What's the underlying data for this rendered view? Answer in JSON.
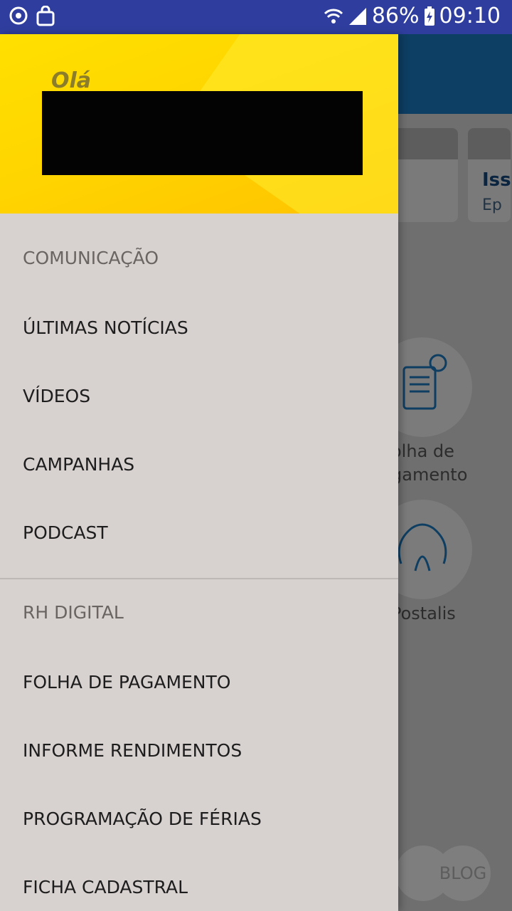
{
  "status_bar": {
    "battery": "86%",
    "time": "09:10"
  },
  "drawer": {
    "greeting": "Olá",
    "sections": [
      {
        "title": "COMUNICAÇÃO",
        "items": [
          "ÚLTIMAS NOTÍCIAS",
          "VÍDEOS",
          "CAMPANHAS",
          "PODCAST"
        ]
      },
      {
        "title": "RH DIGITAL",
        "items": [
          "FOLHA DE PAGAMENTO",
          "INFORME RENDIMENTOS",
          "PROGRAMAÇÃO DE FÉRIAS",
          "FICHA CADASTRAL"
        ]
      }
    ]
  },
  "background": {
    "card_title": "Iss",
    "card_sub": "Ep",
    "shortcut1_label_line1": "olha de",
    "shortcut1_label_line2": "gamento",
    "shortcut2_label": "Postalis",
    "blog_label": "BLOG"
  },
  "colors": {
    "status_bar": "#2f3e9e",
    "drawer_bg": "#d7d1cf",
    "header_yellow": "#ffd400"
  }
}
